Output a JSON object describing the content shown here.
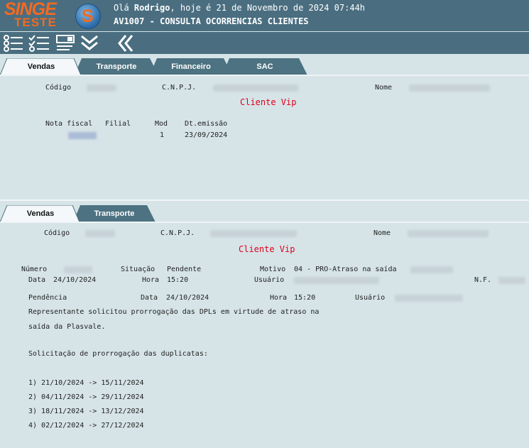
{
  "header": {
    "logo_text": "SINGE",
    "logo_sub": "TESTE",
    "logo_mark": "S",
    "greeting_prefix": "Olá ",
    "greeting_user": "Rodrigo",
    "greeting_suffix": ", hoje é 21 de Novembro de 2024 07:44h",
    "screen_title": "AV1007 - CONSULTA OCORRENCIAS CLIENTES"
  },
  "toolbar": {
    "icons": [
      "list-check-icon",
      "list-check-alt-icon",
      "monitor-list-icon",
      "double-chevron-down-icon",
      "double-chevron-left-icon"
    ]
  },
  "top_tabs": [
    "Vendas",
    "Transporte",
    "Financeiro",
    "SAC"
  ],
  "top_panel": {
    "codigo_label": "Código",
    "cnpj_label": "C.N.P.J.",
    "nome_label": "Nome",
    "vip": "Cliente Vip",
    "nota_fiscal_label": "Nota fiscal",
    "filial_label": "Filial",
    "mod_label": "Mod",
    "dt_emissao_label": "Dt.emissão",
    "mod_value": "1",
    "dt_emissao_value": "23/09/2024"
  },
  "bottom_tabs": [
    "Vendas",
    "Transporte"
  ],
  "bottom_panel": {
    "codigo_label": "Código",
    "cnpj_label": "C.N.P.J.",
    "nome_label": "Nome",
    "vip": "Cliente Vip",
    "numero_label": "Número",
    "situacao_label": "Situação",
    "situacao_value": "Pendente",
    "motivo_label": "Motivo",
    "motivo_value": "04 - PRO-Atraso na saída",
    "data_label": "Data",
    "data_value": "24/10/2024",
    "hora_label": "Hora",
    "hora_value": "15:20",
    "usuario_label": "Usuário",
    "nf_label": "N.F.",
    "pendencia_label": "Pendência",
    "pend_data_label": "Data",
    "pend_data_value": "24/10/2024",
    "pend_hora_label": "Hora",
    "pend_hora_value": "15:20",
    "pend_usuario_label": "Usuário",
    "text_lines": [
      "Representante solicitou prorrogação das DPLs em virtude de atraso na",
      "saída da Plasvale.",
      "",
      "Solicitação de prorrogação das duplicatas:",
      "",
      "1) 21/10/2024 -> 15/11/2024",
      "2) 04/11/2024 -> 29/11/2024",
      "3) 18/11/2024 -> 13/12/2024",
      "4) 02/12/2024 -> 27/12/2024"
    ]
  },
  "colors": {
    "header_bg": "#4a6e80",
    "panel_bg": "#d6e4e8",
    "active_tab": "#f4f8fa",
    "inactive_tab": "#4d7281",
    "vip": "#e0001a",
    "logo_orange": "#f26a21"
  }
}
